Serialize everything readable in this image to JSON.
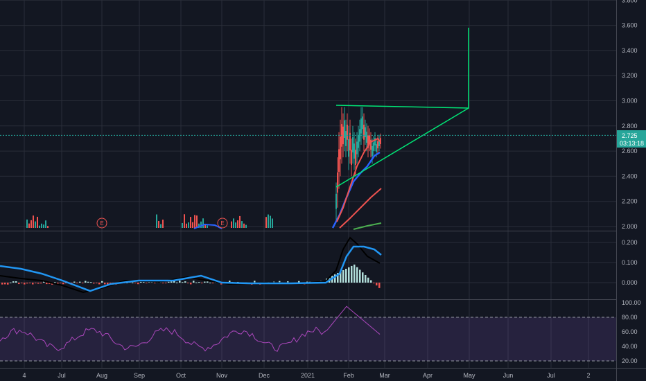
{
  "chart_data": [
    {
      "type": "candlestick",
      "panel": "price",
      "y_ticks": [
        "2.000",
        "2.200",
        "2.400",
        "2.600",
        "2.800",
        "3.000",
        "3.200",
        "3.400",
        "3.600",
        "3.800"
      ],
      "ylim": [
        2.0,
        3.8
      ],
      "last_price": "2.725",
      "countdown": "03:13:18",
      "earnings_markers": [
        "E",
        "E"
      ],
      "grid": true,
      "colors": {
        "up": "#26a69a",
        "down": "#ef5350",
        "ma_fast": "#ef5350",
        "ma_mid": "#2962ff",
        "ma_slow": "#4caf50",
        "drawing": "#00e676",
        "price_line": "#26a69a",
        "badge": "#26a69a"
      }
    },
    {
      "type": "line",
      "panel": "macd",
      "y_ticks": [
        "0.000",
        "0.100",
        "0.200"
      ],
      "ylim": [
        -0.05,
        0.23
      ],
      "series": [
        {
          "values": []
        },
        {
          "values": []
        }
      ],
      "colors": {
        "macd": "#000000",
        "signal": "#2196f3",
        "hist_up": "#b2dfdb",
        "hist_down": "#ef5350"
      }
    },
    {
      "type": "line",
      "panel": "rsi",
      "y_ticks": [
        "20.00",
        "40.00",
        "60.00",
        "80.00",
        "100.00"
      ],
      "ylim": [
        15,
        105
      ],
      "band": [
        20,
        80
      ],
      "colors": {
        "line": "#ab47bc",
        "band": "#7e57c2"
      }
    }
  ],
  "x_ticks": [
    "4",
    "Jul",
    "Aug",
    "Sep",
    "Oct",
    "Nov",
    "Dec",
    "2021",
    "Feb",
    "Mar",
    "Apr",
    "May",
    "Jun",
    "Jul",
    "2"
  ]
}
